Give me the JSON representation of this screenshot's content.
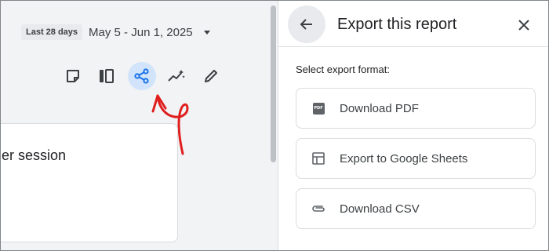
{
  "report": {
    "date_chip": "Last 28 days",
    "date_range": "May 5 - Jun 1, 2025",
    "card_text": "er session"
  },
  "toolbar": {
    "icons": [
      "sticky-note-icon",
      "compare-columns-icon",
      "share-icon",
      "insights-sparkle-icon",
      "edit-pencil-icon"
    ],
    "active": "share-icon"
  },
  "annotation": {
    "arrow_color": "#e01e1e"
  },
  "panel": {
    "title": "Export this report",
    "section_label": "Select export format:",
    "options": [
      {
        "label": "Download PDF",
        "icon": "pdf-icon"
      },
      {
        "label": "Export to Google Sheets",
        "icon": "sheets-grid-icon"
      },
      {
        "label": "Download CSV",
        "icon": "paperclip-icon"
      }
    ]
  },
  "colors": {
    "accent": "#d2e3fc",
    "share_icon": "#1a73e8",
    "text": "#3c4043"
  }
}
